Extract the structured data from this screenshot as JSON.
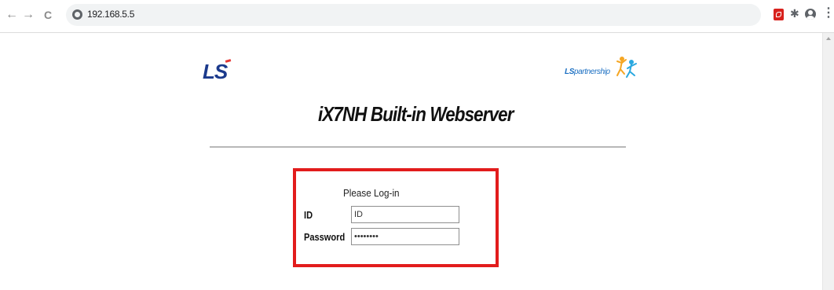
{
  "browser": {
    "back_glyph": "←",
    "forward_glyph": "→",
    "reload_glyph": "C",
    "url": "192.168.5.5",
    "menu_glyph": "⋮",
    "extension_glyph": "✱"
  },
  "page": {
    "logo_text": "LS",
    "partnership_logo": {
      "prefix": "LS",
      "suffix": "partnership"
    },
    "title": "iX7NH Built-in Webserver",
    "login": {
      "caption": "Please Log-in",
      "id_label": "ID",
      "id_value": "ID",
      "password_label": "Password",
      "password_value": "********"
    }
  },
  "colors": {
    "highlight_border": "#e21c1c",
    "ls_blue": "#1b3a8c",
    "ls_red": "#e53935"
  }
}
